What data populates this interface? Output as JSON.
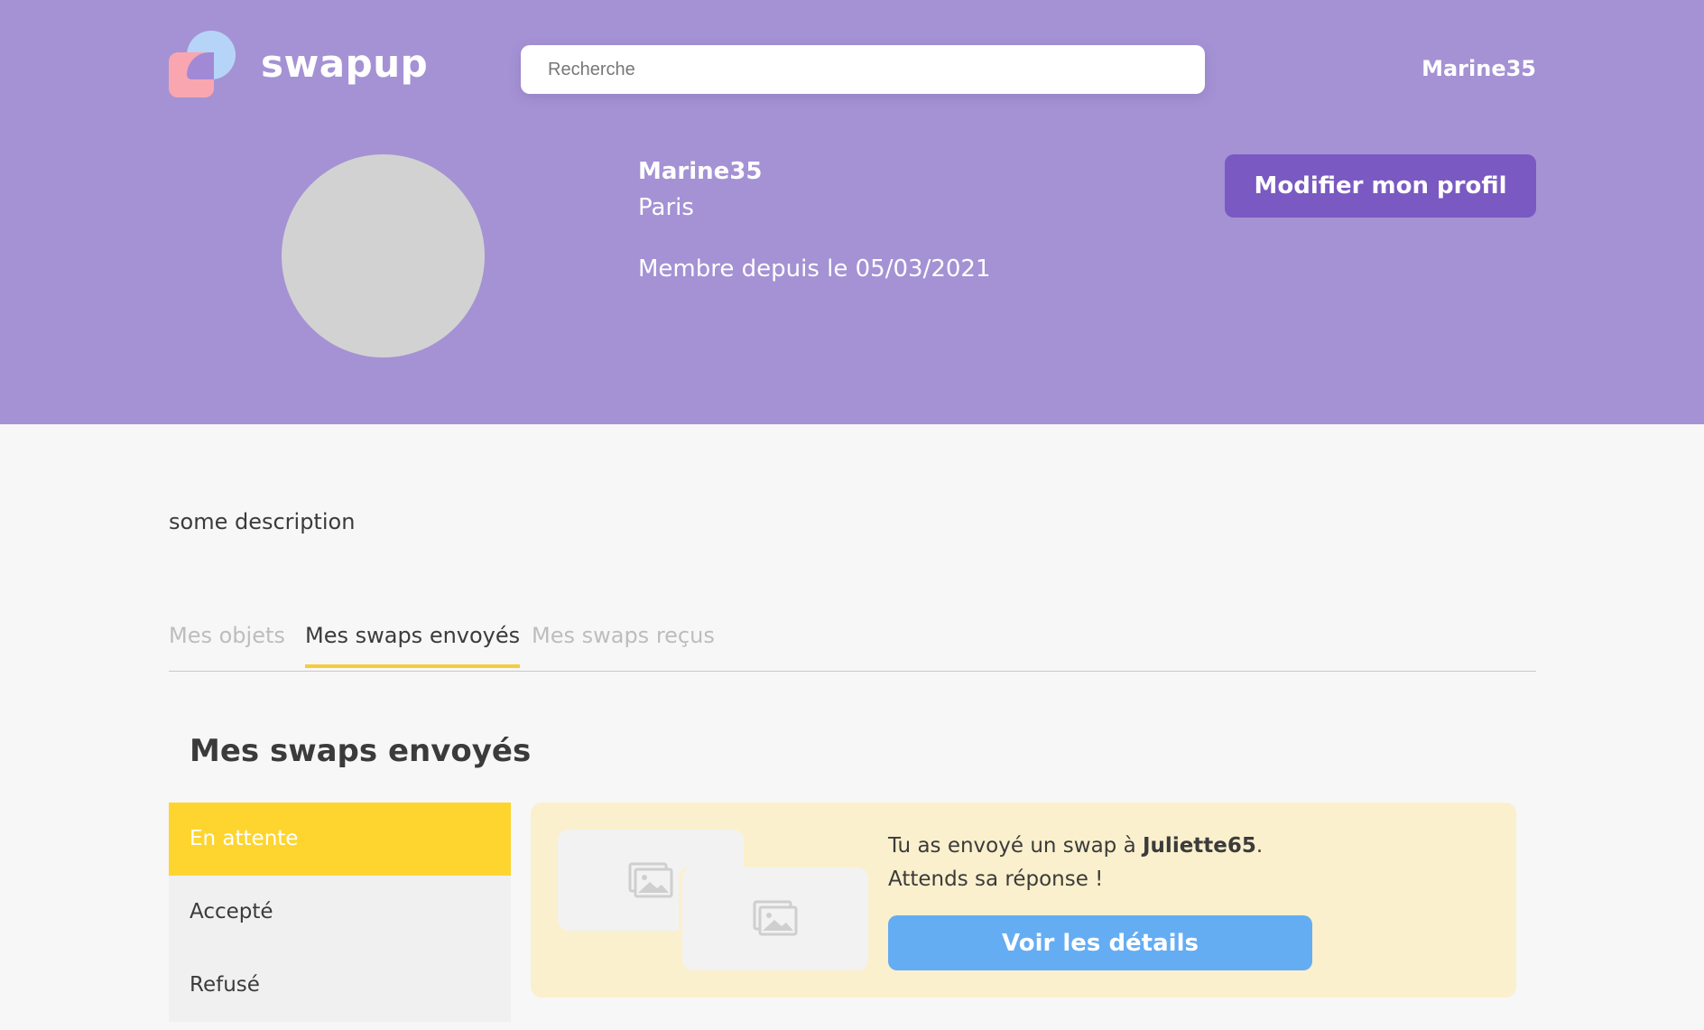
{
  "header": {
    "brand": "swapup",
    "search_placeholder": "Recherche",
    "user_link": "Marine35"
  },
  "profile": {
    "name": "Marine35",
    "city": "Paris",
    "member_since": "Membre depuis le 05/03/2021",
    "edit_button": "Modifier mon profil",
    "description": "some description"
  },
  "tabs": [
    {
      "label": "Mes objets",
      "active": false
    },
    {
      "label": "Mes swaps envoyés",
      "active": true
    },
    {
      "label": "Mes swaps reçus",
      "active": false
    }
  ],
  "section": {
    "title": "Mes swaps envoyés",
    "statuses": [
      {
        "label": "En attente",
        "active": true
      },
      {
        "label": "Accepté",
        "active": false
      },
      {
        "label": "Refusé",
        "active": false
      }
    ]
  },
  "swap_card": {
    "message_prefix": "Tu as envoyé un swap à ",
    "recipient": "Juliette65",
    "message_suffix": ".",
    "message_line2": "Attends sa réponse !",
    "button": "Voir les détails"
  },
  "colors": {
    "header_bg": "#a492d4",
    "primary_button": "#7a59c2",
    "tab_underline": "#f5cd3a",
    "status_active": "#fed52f",
    "card_bg": "#fbf0cd",
    "details_button": "#64adf2",
    "avatar_placeholder": "#d2d2d2"
  }
}
